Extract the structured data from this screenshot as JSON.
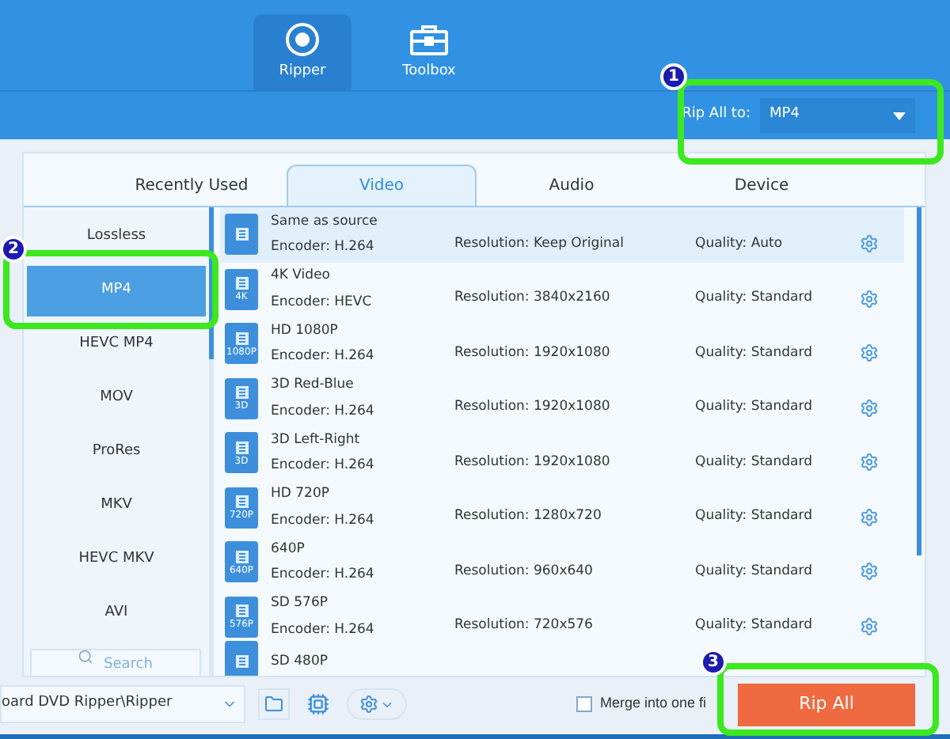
{
  "nav_tabs": [
    {
      "label": "Ripper",
      "selected": true
    },
    {
      "label": "Toolbox",
      "selected": false
    }
  ],
  "rip_all_to": {
    "label": "Rip All to:",
    "value": "MP4"
  },
  "format_tabs": [
    {
      "label": "Recently Used",
      "selected": false
    },
    {
      "label": "Video",
      "selected": true
    },
    {
      "label": "Audio",
      "selected": false
    },
    {
      "label": "Device",
      "selected": false
    }
  ],
  "formats": [
    {
      "label": "Lossless",
      "selected": false
    },
    {
      "label": "MP4",
      "selected": true
    },
    {
      "label": "HEVC MP4",
      "selected": false
    },
    {
      "label": "MOV",
      "selected": false
    },
    {
      "label": "ProRes",
      "selected": false
    },
    {
      "label": "MKV",
      "selected": false
    },
    {
      "label": "HEVC MKV",
      "selected": false
    },
    {
      "label": "AVI",
      "selected": false
    }
  ],
  "search": {
    "placeholder": "Search"
  },
  "presets": [
    {
      "name": "Same as source",
      "encoder": "Encoder: H.264",
      "resolution": "Resolution: Keep Original",
      "quality": "Quality: Auto",
      "selected": true
    },
    {
      "name": "4K Video",
      "badge": "4K",
      "encoder": "Encoder: HEVC",
      "resolution": "Resolution: 3840x2160",
      "quality": "Quality: Standard",
      "selected": false
    },
    {
      "name": "HD 1080P",
      "badge": "1080P",
      "encoder": "Encoder: H.264",
      "resolution": "Resolution: 1920x1080",
      "quality": "Quality: Standard",
      "selected": false
    },
    {
      "name": "3D Red-Blue",
      "badge": "3D",
      "encoder": "Encoder: H.264",
      "resolution": "Resolution: 1920x1080",
      "quality": "Quality: Standard",
      "selected": false
    },
    {
      "name": "3D Left-Right",
      "badge": "3D",
      "encoder": "Encoder: H.264",
      "resolution": "Resolution: 1920x1080",
      "quality": "Quality: Standard",
      "selected": false
    },
    {
      "name": "HD 720P",
      "badge": "720P",
      "encoder": "Encoder: H.264",
      "resolution": "Resolution: 1280x720",
      "quality": "Quality: Standard",
      "selected": false
    },
    {
      "name": "640P",
      "badge": "640P",
      "encoder": "Encoder: H.264",
      "resolution": "Resolution: 960x640",
      "quality": "Quality: Standard",
      "selected": false
    },
    {
      "name": "SD 576P",
      "badge": "576P",
      "encoder": "Encoder: H.264",
      "resolution": "Resolution: 720x576",
      "quality": "Quality: Standard",
      "selected": false
    },
    {
      "name": "SD 480P",
      "selected": false
    }
  ],
  "bottom_bar": {
    "save_path": "oard DVD Ripper\\Ripper",
    "merge": {
      "label": "Merge into one fi",
      "checked": false
    },
    "rip_button": "Rip All"
  },
  "annotations": [
    "1",
    "2",
    "3"
  ]
}
